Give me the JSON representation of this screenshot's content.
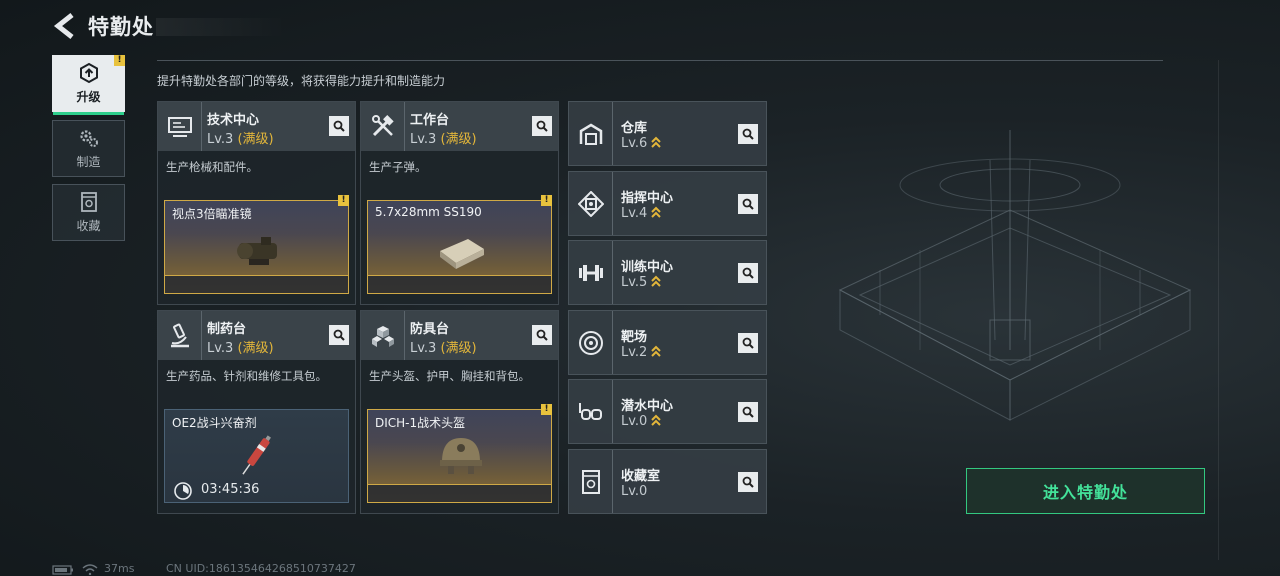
{
  "header": {
    "title": "特勤处",
    "back_icon": "back-arrow-icon"
  },
  "nav": {
    "items": [
      {
        "label": "升级",
        "icon": "upgrade-icon",
        "active": true,
        "alert": "!"
      },
      {
        "label": "制造",
        "icon": "gears-icon",
        "active": false
      },
      {
        "label": "收藏",
        "icon": "collection-icon",
        "active": false
      }
    ]
  },
  "subtitle": "提升特勤处各部门的等级，将获得能力提升和制造能力",
  "workshops": [
    {
      "name": "技术中心",
      "level": "Lv.3",
      "status": "(满级)",
      "desc": "生产枪械和配件。",
      "item": "视点3倍瞄准镜",
      "alert": "!"
    },
    {
      "name": "工作台",
      "level": "Lv.3",
      "status": "(满级)",
      "desc": "生产子弹。",
      "item": "5.7x28mm SS190",
      "alert": "!"
    },
    {
      "name": "制药台",
      "level": "Lv.3",
      "status": "(满级)",
      "desc": "生产药品、针剂和维修工具包。",
      "item": "OE2战斗兴奋剂",
      "timer": "03:45:36"
    },
    {
      "name": "防具台",
      "level": "Lv.3",
      "status": "(满级)",
      "desc": "生产头盔、护甲、胸挂和背包。",
      "item": "DICH-1战术头盔",
      "alert": "!"
    }
  ],
  "facilities": [
    {
      "name": "仓库",
      "level": "Lv.6",
      "icon": "warehouse-icon",
      "upgradable": true
    },
    {
      "name": "指挥中心",
      "level": "Lv.4",
      "icon": "command-center-icon",
      "upgradable": true
    },
    {
      "name": "训练中心",
      "level": "Lv.5",
      "icon": "dumbbell-icon",
      "upgradable": true
    },
    {
      "name": "靶场",
      "level": "Lv.2",
      "icon": "target-icon",
      "upgradable": true
    },
    {
      "name": "潜水中心",
      "level": "Lv.0",
      "icon": "diving-mask-icon",
      "upgradable": true
    },
    {
      "name": "收藏室",
      "level": "Lv.0",
      "icon": "collection-room-icon",
      "upgradable": false
    }
  ],
  "enter_button": "进入特勤处",
  "footer": {
    "ping": "37ms",
    "uid": "CN UID:18613546426851073742​7"
  },
  "colors": {
    "accent_green": "#43e29a",
    "max_gold": "#e3b63a",
    "alert_yellow": "#e8c23d"
  }
}
